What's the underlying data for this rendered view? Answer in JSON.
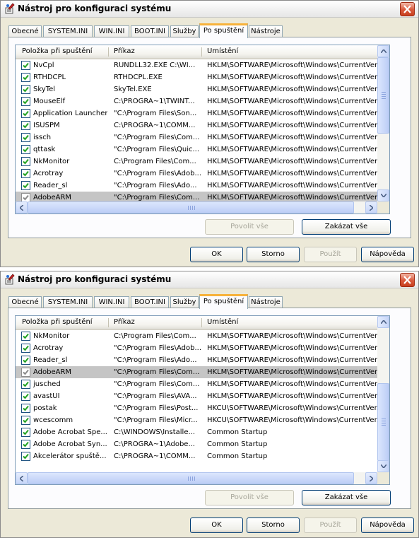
{
  "window1": {
    "title": "Nástroj pro konfiguraci systému",
    "tabs": [
      "Obecné",
      "SYSTEM.INI",
      "WIN.INI",
      "BOOT.INI",
      "Služby",
      "Po spuštění",
      "Nástroje"
    ],
    "active_tab": "Po spuštění",
    "columns": [
      "Položka při spuštění",
      "Příkaz",
      "Umístění"
    ],
    "rows": [
      {
        "item": "NvCpl",
        "command": "RUNDLL32.EXE C:\\WI...",
        "location": "HKLM\\SOFTWARE\\Microsoft\\Windows\\CurrentVer...",
        "checked": true,
        "selected": false
      },
      {
        "item": "RTHDCPL",
        "command": "RTHDCPL.EXE",
        "location": "HKLM\\SOFTWARE\\Microsoft\\Windows\\CurrentVer...",
        "checked": true,
        "selected": false
      },
      {
        "item": "SkyTel",
        "command": "SkyTel.EXE",
        "location": "HKLM\\SOFTWARE\\Microsoft\\Windows\\CurrentVer...",
        "checked": true,
        "selected": false
      },
      {
        "item": "MouseElf",
        "command": "C:\\PROGRA~1\\TWINT...",
        "location": "HKLM\\SOFTWARE\\Microsoft\\Windows\\CurrentVer...",
        "checked": true,
        "selected": false
      },
      {
        "item": "Application Launcher",
        "command": "\"C:\\Program Files\\Son...",
        "location": "HKLM\\SOFTWARE\\Microsoft\\Windows\\CurrentVer...",
        "checked": true,
        "selected": false
      },
      {
        "item": "ISUSPM",
        "command": "C:\\PROGRA~1\\COMM...",
        "location": "HKLM\\SOFTWARE\\Microsoft\\Windows\\CurrentVer...",
        "checked": true,
        "selected": false
      },
      {
        "item": "issch",
        "command": "\"C:\\Program Files\\Com...",
        "location": "HKLM\\SOFTWARE\\Microsoft\\Windows\\CurrentVer...",
        "checked": true,
        "selected": false
      },
      {
        "item": "qttask",
        "command": "\"C:\\Program Files\\Quic...",
        "location": "HKLM\\SOFTWARE\\Microsoft\\Windows\\CurrentVer...",
        "checked": true,
        "selected": false
      },
      {
        "item": "NkMonitor",
        "command": "C:\\Program Files\\Com...",
        "location": "HKLM\\SOFTWARE\\Microsoft\\Windows\\CurrentVer...",
        "checked": true,
        "selected": false
      },
      {
        "item": "Acrotray",
        "command": "\"C:\\Program Files\\Adob...",
        "location": "HKLM\\SOFTWARE\\Microsoft\\Windows\\CurrentVer...",
        "checked": true,
        "selected": false
      },
      {
        "item": "Reader_sl",
        "command": "\"C:\\Program Files\\Ado...",
        "location": "HKLM\\SOFTWARE\\Microsoft\\Windows\\CurrentVer...",
        "checked": true,
        "selected": false
      },
      {
        "item": "AdobeARM",
        "command": "\"C:\\Program Files\\Com...",
        "location": "HKLM\\SOFTWARE\\Microsoft\\Windows\\CurrentVer...",
        "checked": true,
        "selected": true
      }
    ],
    "enable_all": "Povolit vše",
    "disable_all": "Zakázat vše",
    "ok": "OK",
    "cancel": "Storno",
    "apply": "Použít",
    "help": "Nápověda"
  },
  "window2": {
    "title": "Nástroj pro konfiguraci systému",
    "tabs": [
      "Obecné",
      "SYSTEM.INI",
      "WIN.INI",
      "BOOT.INI",
      "Služby",
      "Po spuštění",
      "Nástroje"
    ],
    "active_tab": "Po spuštění",
    "columns": [
      "Položka při spuštění",
      "Příkaz",
      "Umístění"
    ],
    "rows": [
      {
        "item": "NkMonitor",
        "command": "C:\\Program Files\\Com...",
        "location": "HKLM\\SOFTWARE\\Microsoft\\Windows\\CurrentVer...",
        "checked": true,
        "selected": false
      },
      {
        "item": "Acrotray",
        "command": "\"C:\\Program Files\\Adob...",
        "location": "HKLM\\SOFTWARE\\Microsoft\\Windows\\CurrentVer...",
        "checked": true,
        "selected": false
      },
      {
        "item": "Reader_sl",
        "command": "\"C:\\Program Files\\Ado...",
        "location": "HKLM\\SOFTWARE\\Microsoft\\Windows\\CurrentVer...",
        "checked": true,
        "selected": false
      },
      {
        "item": "AdobeARM",
        "command": "\"C:\\Program Files\\Com...",
        "location": "HKLM\\SOFTWARE\\Microsoft\\Windows\\CurrentVer...",
        "checked": true,
        "selected": true
      },
      {
        "item": "jusched",
        "command": "\"C:\\Program Files\\Com...",
        "location": "HKLM\\SOFTWARE\\Microsoft\\Windows\\CurrentVer...",
        "checked": true,
        "selected": false
      },
      {
        "item": "avastUI",
        "command": "\"C:\\Program Files\\AVA...",
        "location": "HKLM\\SOFTWARE\\Microsoft\\Windows\\CurrentVer...",
        "checked": true,
        "selected": false
      },
      {
        "item": "postak",
        "command": "\"C:\\Program Files\\Post...",
        "location": "HKCU\\SOFTWARE\\Microsoft\\Windows\\CurrentVer...",
        "checked": true,
        "selected": false
      },
      {
        "item": "wcescomm",
        "command": "\"C:\\Program Files\\Micr...",
        "location": "HKCU\\SOFTWARE\\Microsoft\\Windows\\CurrentVer...",
        "checked": true,
        "selected": false
      },
      {
        "item": "Adobe Acrobat Spe...",
        "command": "C:\\WINDOWS\\Installe...",
        "location": "Common Startup",
        "checked": true,
        "selected": false
      },
      {
        "item": "Adobe Acrobat Syn...",
        "command": "C:\\PROGRA~1\\Adobe...",
        "location": "Common Startup",
        "checked": true,
        "selected": false
      },
      {
        "item": "Akcelerátor spuště...",
        "command": "C:\\PROGRA~1\\COMM...",
        "location": "Common Startup",
        "checked": true,
        "selected": false
      }
    ],
    "enable_all": "Povolit vše",
    "disable_all": "Zakázat vše",
    "ok": "OK",
    "cancel": "Storno",
    "apply": "Použít",
    "help": "Nápověda"
  },
  "colors": {
    "window_bg": "#ece9d8",
    "active_tab_accent": "#f7b23a",
    "checkmark": "#21a121",
    "selected_row": "#c5c5c5",
    "close_button": "#d9573a"
  },
  "icons": [
    "app-config-icon",
    "close-icon",
    "checkbox-check-icon",
    "scroll-up-icon",
    "scroll-down-icon",
    "scroll-left-icon",
    "scroll-right-icon"
  ]
}
